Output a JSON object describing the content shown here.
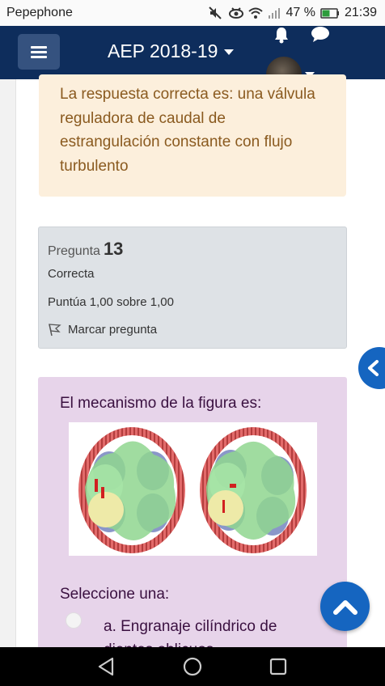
{
  "status_bar": {
    "carrier": "Pepephone",
    "battery": "47 %",
    "time": "21:39"
  },
  "navbar": {
    "course_title": "AEP 2018-19",
    "icons": [
      "menu-icon",
      "bell-icon",
      "chat-icon",
      "avatar",
      "chevron-down-icon"
    ]
  },
  "feedback": {
    "text": "La respuesta correcta es: una válvula reguladora de caudal de estrangulación constante con flujo turbulento"
  },
  "question_info": {
    "label": "Pregunta",
    "number": "13",
    "state": "Correcta",
    "grade": "Puntúa 1,00 sobre 1,00",
    "flag_label": "Marcar pregunta"
  },
  "question": {
    "text": "El mecanismo de la figura es:",
    "select_label": "Seleccione una:",
    "options": [
      {
        "label": "a. Engranaje cilíndrico de dientes oblicuos"
      }
    ]
  },
  "colors": {
    "navbar": "#0e2d5c",
    "feedback_bg": "#fcefdc",
    "info_bg": "#dee2e6",
    "question_bg": "#e7d4ea",
    "accent": "#1565c0"
  }
}
